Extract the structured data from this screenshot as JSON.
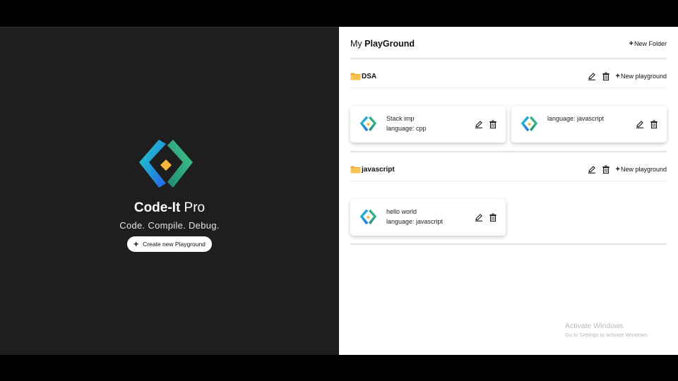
{
  "left": {
    "brand_strong": "Code-It",
    "brand_light": " Pro",
    "tagline": "Code. Compile. Debug.",
    "create_button": "Create new Playground"
  },
  "header": {
    "title_prefix": "My ",
    "title_strong": "PlayGround",
    "new_folder": "New Folder"
  },
  "folders": [
    {
      "name": "DSA",
      "new_playground": "New playground",
      "cards": [
        {
          "title": "Stack imp",
          "language": "language: cpp"
        },
        {
          "title": "",
          "language": "language: javascript"
        }
      ]
    },
    {
      "name": "javascript",
      "new_playground": "New playground",
      "cards": [
        {
          "title": "hello world",
          "language": "language: javascript"
        }
      ]
    }
  ],
  "watermark": {
    "line1": "Activate Windows",
    "line2": "Go to Settings to activate Windows."
  },
  "colors": {
    "left_bg": "#1e1e1e",
    "folder": "#f4b43a",
    "logo_cyan": "#1ec8c8",
    "logo_blue": "#2a7be4",
    "logo_green": "#3aa97a",
    "logo_diamond": "#f6b73c"
  }
}
